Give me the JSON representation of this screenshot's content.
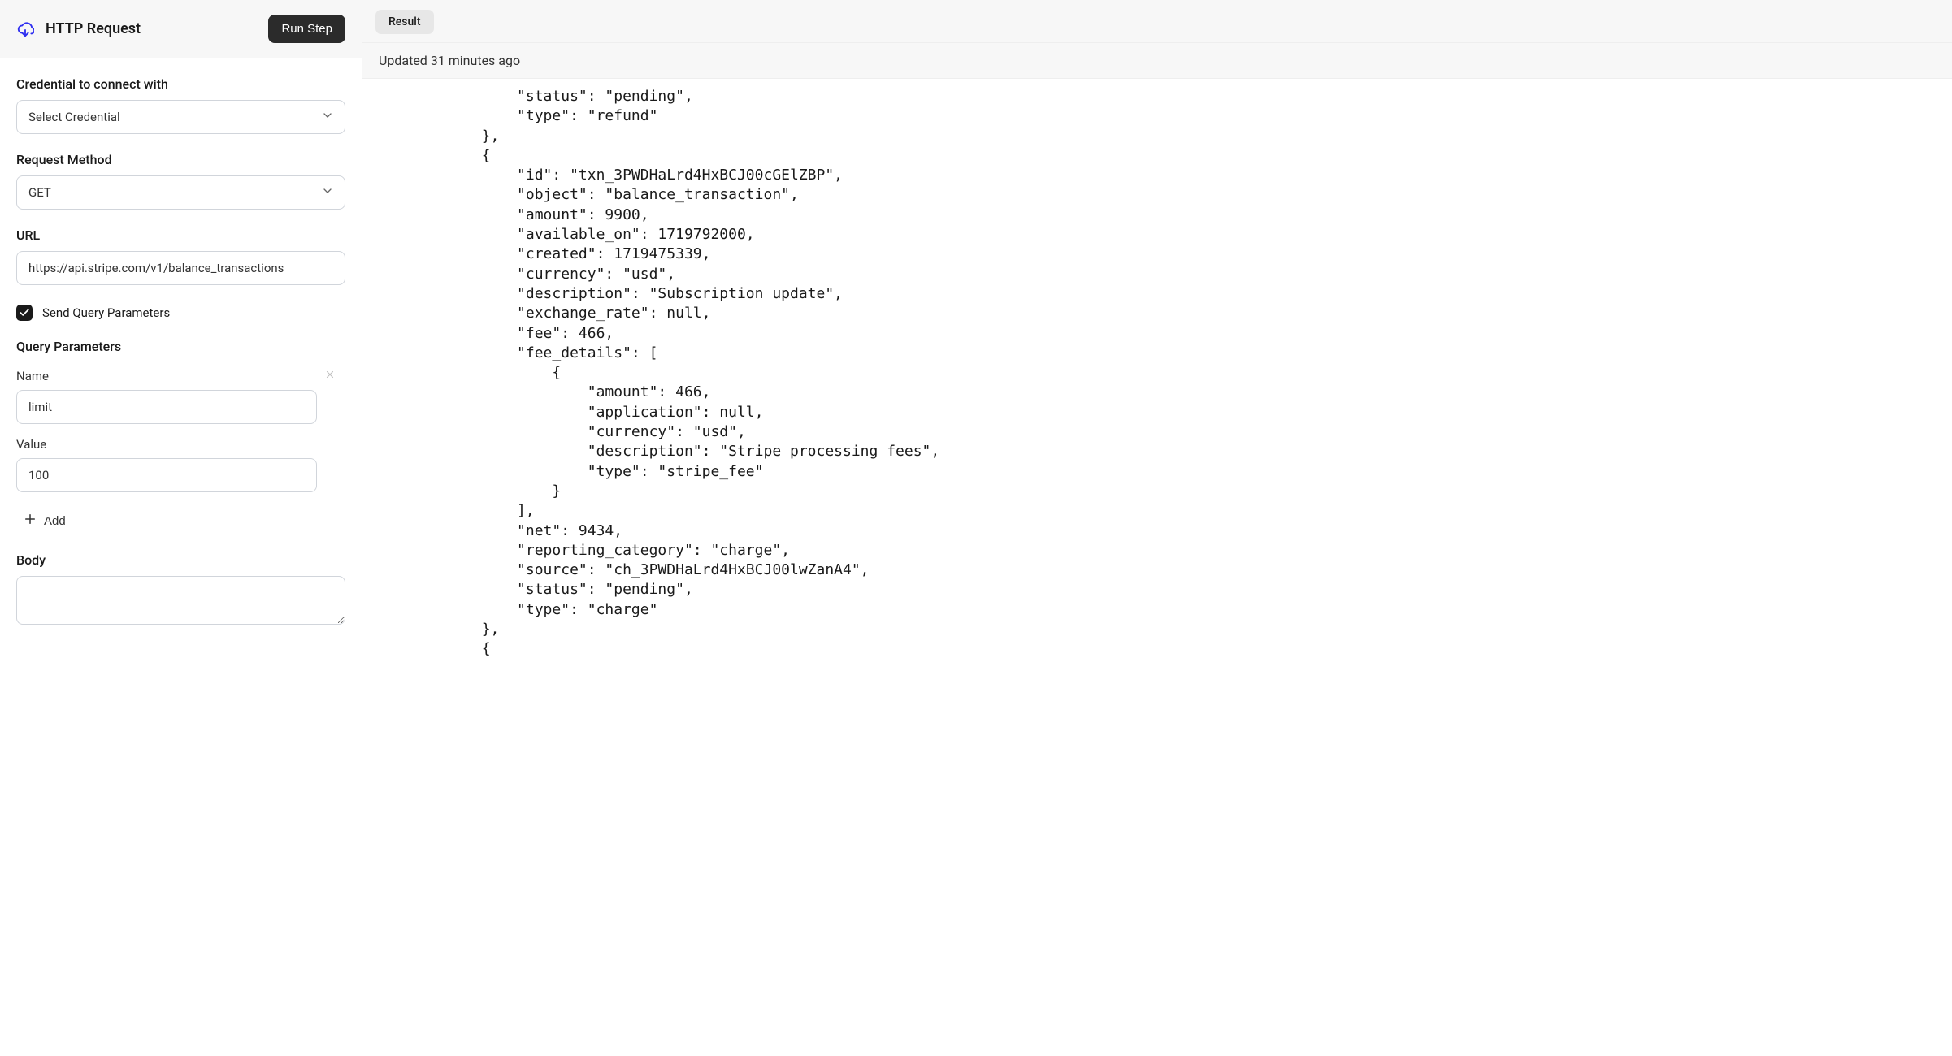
{
  "header": {
    "title": "HTTP Request",
    "run_button": "Run Step"
  },
  "form": {
    "credential_label": "Credential to connect with",
    "credential_placeholder": "Select Credential",
    "method_label": "Request Method",
    "method_value": "GET",
    "url_label": "URL",
    "url_value": "https://api.stripe.com/v1/balance_transactions",
    "send_query_label": "Send Query Parameters",
    "send_query_checked": true,
    "query_params_label": "Query Parameters",
    "param_name_label": "Name",
    "param_value_label": "Value",
    "params": [
      {
        "name": "limit",
        "value": "100"
      }
    ],
    "add_label": "Add",
    "body_label": "Body",
    "body_value": ""
  },
  "result": {
    "tab_label": "Result",
    "updated_text": "Updated 31 minutes ago",
    "code": "            \"status\": \"pending\",\n            \"type\": \"refund\"\n        },\n        {\n            \"id\": \"txn_3PWDHaLrd4HxBCJ00cGElZBP\",\n            \"object\": \"balance_transaction\",\n            \"amount\": 9900,\n            \"available_on\": 1719792000,\n            \"created\": 1719475339,\n            \"currency\": \"usd\",\n            \"description\": \"Subscription update\",\n            \"exchange_rate\": null,\n            \"fee\": 466,\n            \"fee_details\": [\n                {\n                    \"amount\": 466,\n                    \"application\": null,\n                    \"currency\": \"usd\",\n                    \"description\": \"Stripe processing fees\",\n                    \"type\": \"stripe_fee\"\n                }\n            ],\n            \"net\": 9434,\n            \"reporting_category\": \"charge\",\n            \"source\": \"ch_3PWDHaLrd4HxBCJ00lwZanA4\",\n            \"status\": \"pending\",\n            \"type\": \"charge\"\n        },\n        {"
  }
}
